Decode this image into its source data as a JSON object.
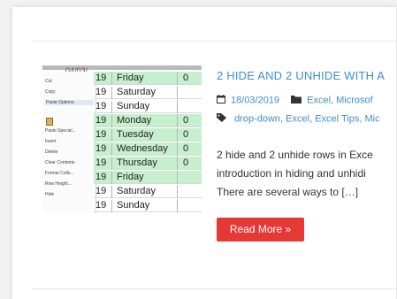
{
  "post": {
    "title": "2 HIDE AND 2 UNHIDE WITH A",
    "date": "18/03/2019",
    "categories": "Excel, Microsof",
    "tags_line": [
      {
        "text": "drop-down",
        "sep": ", "
      },
      {
        "text": "Excel",
        "sep": ", "
      },
      {
        "text": "Excel Tips",
        "sep": ", "
      },
      {
        "text": "Mic",
        "sep": ""
      }
    ],
    "excerpt_lines": [
      "2 hide and 2 unhide rows in Exce",
      "introduction in hiding and unhidi",
      "There are several ways to […]"
    ],
    "read_more_label": "Read More »"
  },
  "thumbnail": {
    "topbar_text": "04/03/",
    "context_menu": [
      "Cut",
      "Copy",
      "Paste Options:",
      "",
      "Paste Special...",
      "Insert",
      "Delete",
      "Clear Contents",
      "Format Cells...",
      "Row Height...",
      "Hide"
    ],
    "rows": [
      {
        "num": "19",
        "day": "Friday",
        "val": "0",
        "green": true
      },
      {
        "num": "19",
        "day": "Saturday",
        "val": "",
        "green": false
      },
      {
        "num": "19",
        "day": "Sunday",
        "val": "",
        "green": false
      },
      {
        "num": "19",
        "day": "Monday",
        "val": "0",
        "green": true
      },
      {
        "num": "19",
        "day": "Tuesday",
        "val": "0",
        "green": true
      },
      {
        "num": "19",
        "day": "Wednesday",
        "val": "0",
        "green": true
      },
      {
        "num": "19",
        "day": "Thursday",
        "val": "0",
        "green": true
      },
      {
        "num": "19",
        "day": "Friday",
        "val": "",
        "green": true
      },
      {
        "num": "19",
        "day": "Saturday",
        "val": "",
        "green": false
      },
      {
        "num": "19",
        "day": "Sunday",
        "val": "",
        "green": false
      }
    ]
  },
  "colors": {
    "link": "#3e8fd1",
    "button": "#e53935",
    "row_green": "#c6efce"
  },
  "icons": {
    "date": "calendar-icon",
    "category": "folder-icon",
    "tags": "tag-icon"
  }
}
